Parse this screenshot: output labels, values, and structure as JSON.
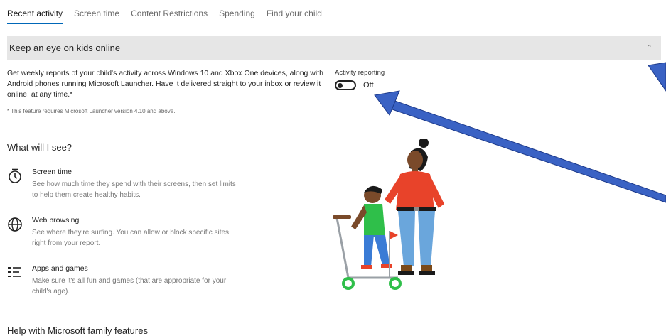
{
  "tabs": [
    {
      "label": "Recent activity"
    },
    {
      "label": "Screen time"
    },
    {
      "label": "Content Restrictions"
    },
    {
      "label": "Spending"
    },
    {
      "label": "Find your child"
    }
  ],
  "section": {
    "title": "Keep an eye on kids online",
    "description": "Get weekly reports of your child's activity across Windows 10 and Xbox One devices, along with Android phones running Microsoft Launcher. Have it delivered straight to your inbox or review it online, at any time.*",
    "note": "* This feature requires Microsoft Launcher version 4.10 and above."
  },
  "activity_reporting": {
    "label": "Activity reporting",
    "state": "Off"
  },
  "what_heading": "What will I see?",
  "features": [
    {
      "icon": "timer-icon",
      "title": "Screen time",
      "desc": "See how much time they spend with their screens, then set limits to help them create healthy habits."
    },
    {
      "icon": "globe-icon",
      "title": "Web browsing",
      "desc": "See where they're surfing. You can allow or block specific sites right from your report."
    },
    {
      "icon": "apps-list-icon",
      "title": "Apps and games",
      "desc": "Make sure it's all fun and games (that are appropriate for your child's age)."
    }
  ],
  "help_heading": "Help with Microsoft family features",
  "colors": {
    "accent": "#0067b8",
    "arrow": "#3a62c4",
    "header_bg": "#e6e6e6"
  }
}
